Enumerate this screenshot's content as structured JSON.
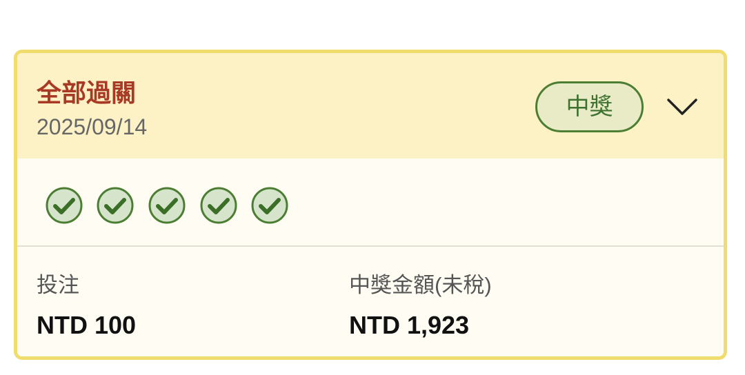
{
  "ticket": {
    "title": "全部過關",
    "date": "2025/09/14",
    "status_badge": "中獎",
    "expand_icon": "chevron-down-icon",
    "results": [
      "check-circle-icon",
      "check-circle-icon",
      "check-circle-icon",
      "check-circle-icon",
      "check-circle-icon"
    ],
    "bet_label": "投注",
    "bet_amount": "NTD 100",
    "prize_label": "中獎金額(未稅)",
    "prize_amount": "NTD 1,923"
  },
  "colors": {
    "card_border": "#f1dc6e",
    "header_bg": "#fdf1c6",
    "body_bg": "#fffdf3",
    "title": "#a83a25",
    "win_green": "#4b7d33",
    "badge_bg": "#e9ebc6"
  }
}
